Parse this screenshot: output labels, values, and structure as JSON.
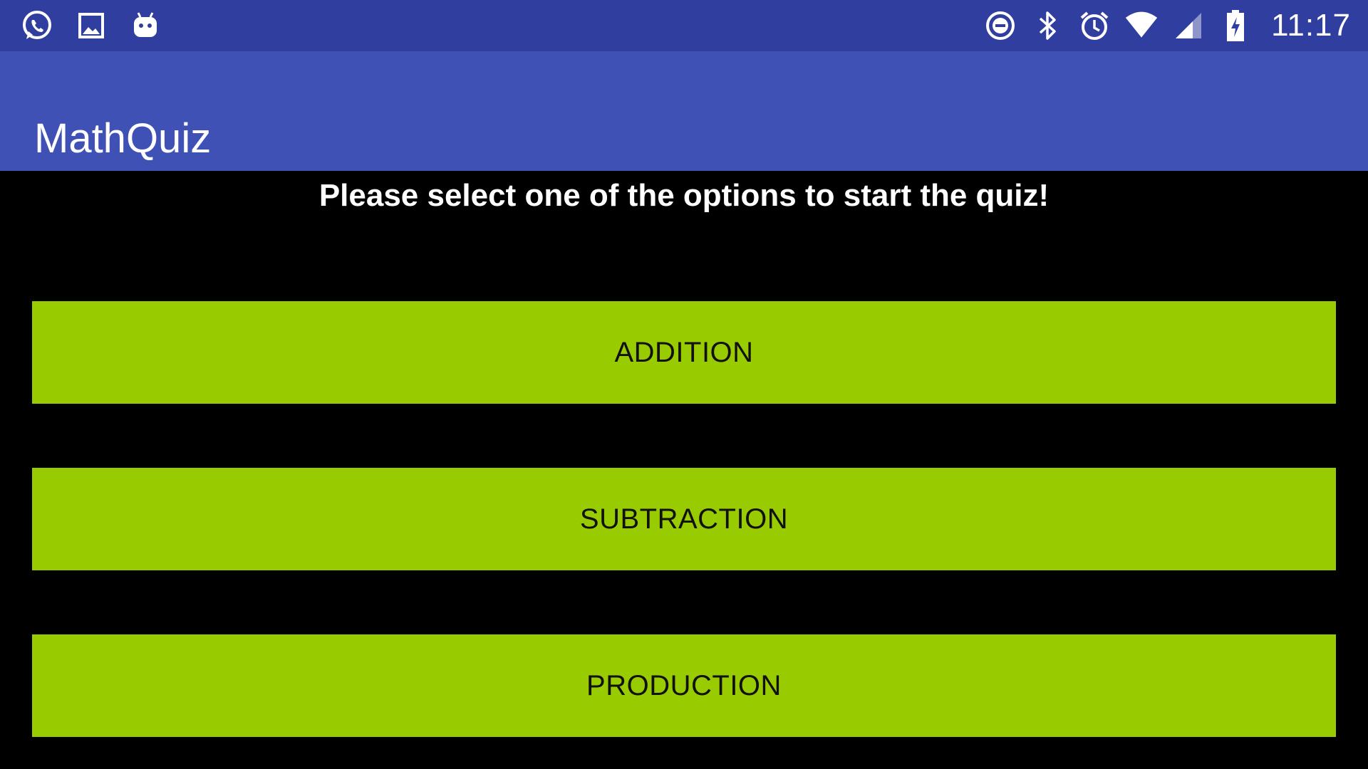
{
  "status_bar": {
    "left_icons": [
      "whatsapp-icon",
      "gallery-image-icon",
      "android-debug-icon"
    ],
    "right_icons": [
      "do-not-disturb-icon",
      "bluetooth-icon",
      "alarm-clock-icon",
      "wifi-icon",
      "cell-signal-icon",
      "battery-charging-icon"
    ],
    "time": "11:17",
    "background_color": "#303F9F"
  },
  "app_bar": {
    "title": "MathQuiz",
    "background_color": "#3F51B5"
  },
  "main": {
    "prompt": "Please select one of the options to start the quiz!",
    "buttons": [
      {
        "label": "ADDITION"
      },
      {
        "label": "SUBTRACTION"
      },
      {
        "label": "PRODUCTION"
      }
    ],
    "button_color": "#99CC00",
    "background_color": "#000000"
  }
}
